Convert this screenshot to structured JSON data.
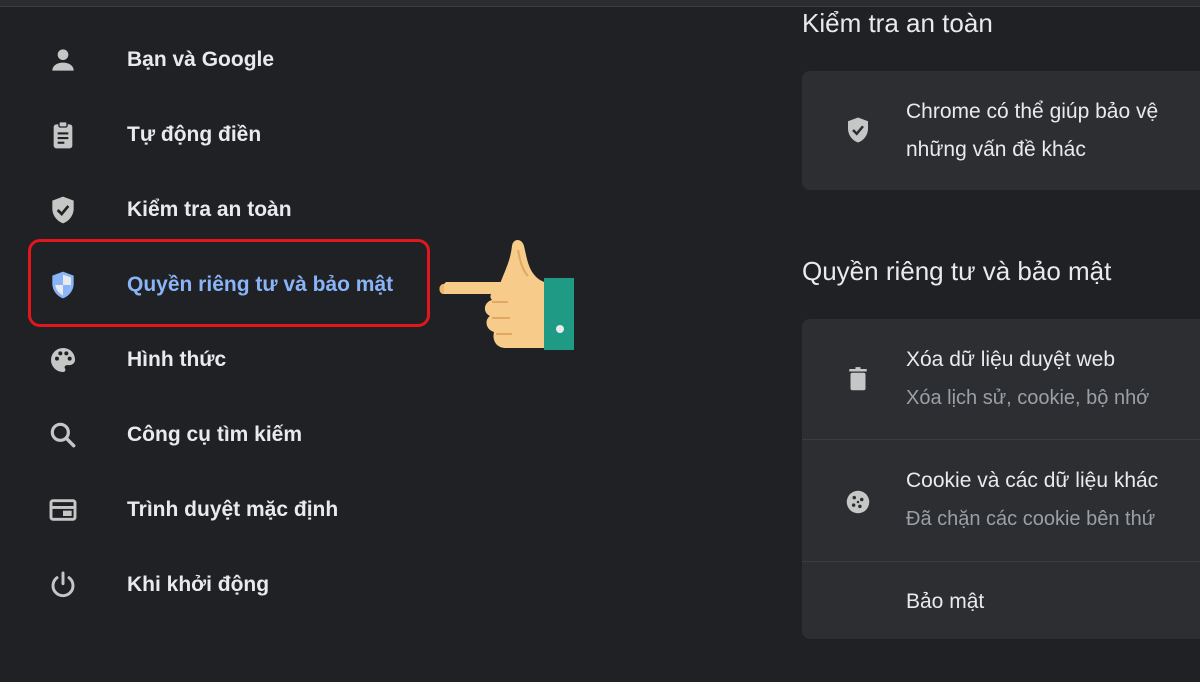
{
  "sidebar": {
    "items": [
      {
        "label": "Bạn và Google",
        "icon": "person-icon"
      },
      {
        "label": "Tự động điền",
        "icon": "clipboard-icon"
      },
      {
        "label": "Kiểm tra an toàn",
        "icon": "shield-check-icon"
      },
      {
        "label": "Quyền riêng tư và bảo mật",
        "icon": "shield-half-icon",
        "active": true
      },
      {
        "label": "Hình thức",
        "icon": "palette-icon"
      },
      {
        "label": "Công cụ tìm kiếm",
        "icon": "search-icon"
      },
      {
        "label": "Trình duyệt mặc định",
        "icon": "browser-window-icon"
      },
      {
        "label": "Khi khởi động",
        "icon": "power-icon"
      }
    ]
  },
  "main": {
    "safety_check": {
      "title": "Kiểm tra an toàn",
      "text_line1": "Chrome có thể giúp bảo vệ",
      "text_line2": "những vấn đề khác"
    },
    "privacy": {
      "title": "Quyền riêng tư và bảo mật",
      "rows": [
        {
          "title": "Xóa dữ liệu duyệt web",
          "subtitle": "Xóa lịch sử, cookie, bộ nhớ",
          "icon": "trash-icon"
        },
        {
          "title": "Cookie và các dữ liệu khác",
          "subtitle": "Đã chặn các cookie bên thứ",
          "icon": "cookie-icon"
        },
        {
          "title": "Bảo mật",
          "subtitle": "",
          "icon": "lock-icon"
        }
      ]
    }
  },
  "colors": {
    "background": "#202124",
    "card": "#2d2e31",
    "active_text": "#8ab4f8",
    "highlight_border": "#e0171c",
    "icon": "#c4c7c5"
  }
}
